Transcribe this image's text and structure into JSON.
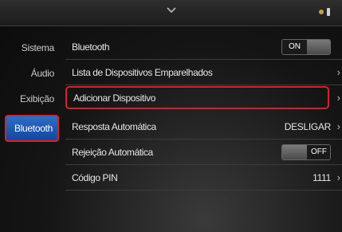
{
  "sidebar": {
    "items": [
      {
        "label": "Sistema"
      },
      {
        "label": "Áudio"
      },
      {
        "label": "Exibição"
      },
      {
        "label": "Bluetooth",
        "active": true
      }
    ]
  },
  "rows": [
    {
      "label": "Bluetooth",
      "toggle": {
        "state": "ON"
      }
    },
    {
      "label": "Lista de Dispositivos Emparelhados"
    },
    {
      "label": "Adicionar Dispositivo",
      "highlighted": true
    },
    {
      "label": "Resposta Automática",
      "value": "DESLIGAR"
    },
    {
      "label": "Rejeição Automática",
      "toggle": {
        "state": "OFF"
      }
    },
    {
      "label": "Código PIN",
      "value": "1111"
    }
  ],
  "colors": {
    "accent": "#1e5ab4",
    "highlight_border": "#d2232a"
  },
  "icons": [
    "chevron-down-icon",
    "status-indicator-icon",
    "chevron-right-icon"
  ]
}
